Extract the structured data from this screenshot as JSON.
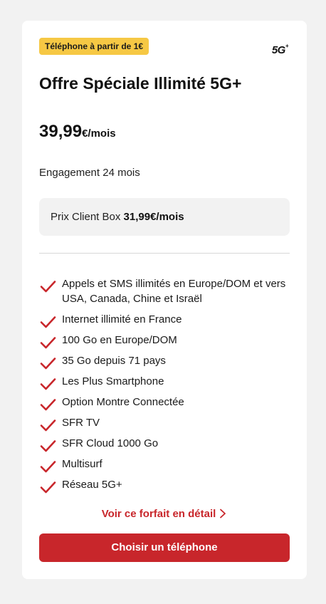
{
  "offer": {
    "badge": "Téléphone à partir de 1€",
    "network_logo": "5G",
    "network_logo_sup": "+",
    "title": "Offre Spéciale Illimité 5G+",
    "price_amount": "39,99",
    "price_unit": "€/mois",
    "engagement": "Engagement 24 mois",
    "box_price_label": "Prix Client Box ",
    "box_price_value": "31,99€/mois",
    "features": [
      "Appels et SMS illimités en Europe/DOM et vers USA, Canada, Chine et Israël",
      "Internet illimité en France",
      "100 Go en Europe/DOM",
      "35 Go depuis 71 pays",
      "Les Plus Smartphone",
      "Option Montre Connectée",
      "SFR TV",
      "SFR Cloud 1000 Go",
      "Multisurf",
      "Réseau 5G+"
    ],
    "detail_link": "Voir ce forfait en détail",
    "cta": "Choisir un téléphone"
  },
  "icons": {
    "check": "check-icon",
    "chevron": "chevron-right-icon"
  },
  "colors": {
    "accent": "#c8262b",
    "badge_bg": "#f6c844",
    "page_bg": "#f2f2f2",
    "card_bg": "#ffffff",
    "box_bg": "#f2f2f2"
  }
}
